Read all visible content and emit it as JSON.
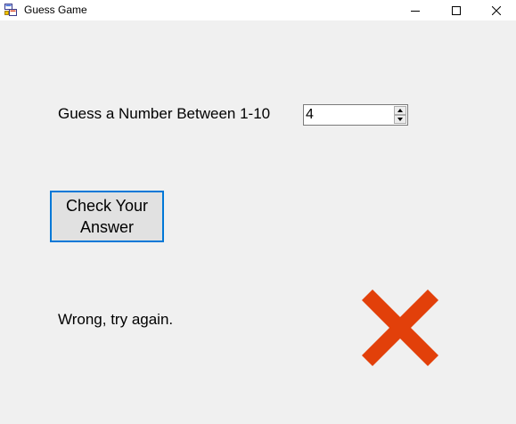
{
  "window": {
    "title": "Guess Game",
    "icon": "windows-forms-app-icon"
  },
  "title_buttons": {
    "minimize_icon": "minimize-icon",
    "maximize_icon": "maximize-icon",
    "close_icon": "close-icon"
  },
  "form": {
    "prompt_label": "Guess a Number Between 1-10",
    "guess_value": "4",
    "spinner_up_icon": "chevron-up-icon",
    "spinner_down_icon": "chevron-down-icon",
    "check_button_label": "Check Your Answer",
    "result_text": "Wrong, try again.",
    "result_icon": "red-x-icon"
  },
  "colors": {
    "background": "#f0f0f0",
    "button_focus_border": "#0078d7",
    "wrong_mark": "#e2400a"
  }
}
